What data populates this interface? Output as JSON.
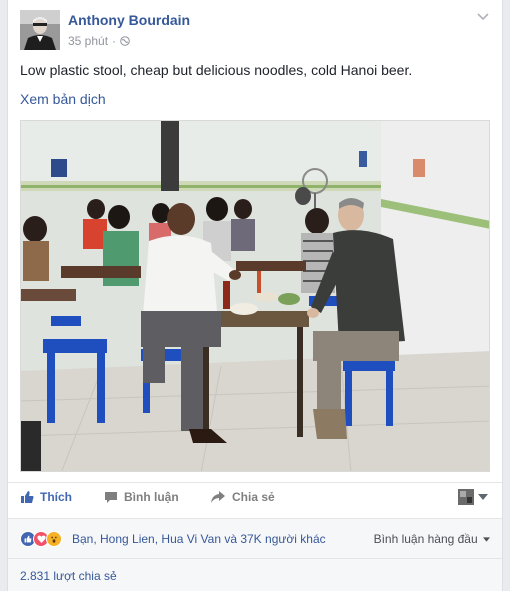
{
  "post": {
    "author": "Anthony Bourdain",
    "time": "35 phút",
    "privacy_icon": "globe-icon",
    "text": "Low plastic stool, cheap but delicious noodles, cold Hanoi beer.",
    "translate_label": "Xem bản dịch"
  },
  "actions": {
    "like_label": "Thích",
    "comment_label": "Bình luận",
    "share_label": "Chia sẻ"
  },
  "reactions": {
    "summary": "Bạn, Hong Lien, Hua Vi Van và 37K người khác",
    "sort_label": "Bình luận hàng đầu"
  },
  "shares": {
    "text": "2.831 lượt chia sẻ"
  },
  "colors": {
    "link": "#365899",
    "like_blue": "#4267b2",
    "love_red": "#f25268",
    "wow_yellow": "#f7b125"
  }
}
